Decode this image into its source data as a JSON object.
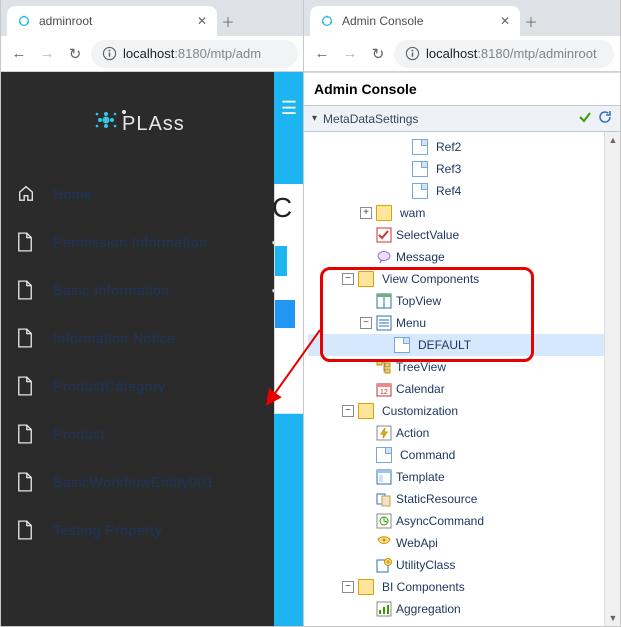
{
  "left": {
    "tab_title": "adminroot",
    "address_host": "localhost",
    "address_port": ":8180",
    "address_path": "/mtp/adm",
    "sidebar": [
      {
        "label": "Home",
        "icon": "home",
        "dots": false
      },
      {
        "label": "Permission Information",
        "icon": "document",
        "dots": true
      },
      {
        "label": "Basic Information",
        "icon": "document",
        "dots": true
      },
      {
        "label": "Information Notice",
        "icon": "document",
        "dots": false
      },
      {
        "label": "ProductCategory",
        "icon": "document",
        "dots": false
      },
      {
        "label": "Product",
        "icon": "document",
        "dots": false
      },
      {
        "label": "BasicWorkflowEntity001",
        "icon": "document",
        "dots": false
      },
      {
        "label": "Testing Property",
        "icon": "document",
        "dots": false
      }
    ]
  },
  "right": {
    "tab_title": "Admin Console",
    "address_host": "localhost",
    "address_port": ":8180",
    "address_path": "/mtp/adminroot",
    "panel_title": "Admin Console",
    "panel_section": "MetaDataSettings",
    "tree": [
      {
        "depth": 4,
        "exp": "",
        "icon": "page",
        "label": "Ref2"
      },
      {
        "depth": 4,
        "exp": "",
        "icon": "page",
        "label": "Ref3"
      },
      {
        "depth": 4,
        "exp": "",
        "icon": "page",
        "label": "Ref4"
      },
      {
        "depth": 2,
        "exp": "+",
        "icon": "folder",
        "label": "wam"
      },
      {
        "depth": 2,
        "exp": "",
        "icon": "check",
        "label": "SelectValue"
      },
      {
        "depth": 2,
        "exp": "",
        "icon": "bubble",
        "label": "Message"
      },
      {
        "depth": 1,
        "exp": "-",
        "icon": "folder",
        "label": "View Components"
      },
      {
        "depth": 2,
        "exp": "",
        "icon": "grid",
        "label": "TopView"
      },
      {
        "depth": 2,
        "exp": "-",
        "icon": "list",
        "label": "Menu"
      },
      {
        "depth": 3,
        "exp": "",
        "icon": "page",
        "label": "DEFAULT",
        "selected": true
      },
      {
        "depth": 2,
        "exp": "",
        "icon": "tree",
        "label": "TreeView"
      },
      {
        "depth": 2,
        "exp": "",
        "icon": "cal",
        "label": "Calendar"
      },
      {
        "depth": 1,
        "exp": "-",
        "icon": "folder",
        "label": "Customization"
      },
      {
        "depth": 2,
        "exp": "",
        "icon": "bolt",
        "label": "Action"
      },
      {
        "depth": 2,
        "exp": "",
        "icon": "page",
        "label": "Command"
      },
      {
        "depth": 2,
        "exp": "",
        "icon": "tmpl",
        "label": "Template"
      },
      {
        "depth": 2,
        "exp": "",
        "icon": "res",
        "label": "StaticResource"
      },
      {
        "depth": 2,
        "exp": "",
        "icon": "async",
        "label": "AsyncCommand"
      },
      {
        "depth": 2,
        "exp": "",
        "icon": "web",
        "label": "WebApi"
      },
      {
        "depth": 2,
        "exp": "",
        "icon": "util",
        "label": "UtilityClass"
      },
      {
        "depth": 1,
        "exp": "-",
        "icon": "folder",
        "label": "BI Components"
      },
      {
        "depth": 2,
        "exp": "",
        "icon": "agg",
        "label": "Aggregation"
      }
    ]
  }
}
